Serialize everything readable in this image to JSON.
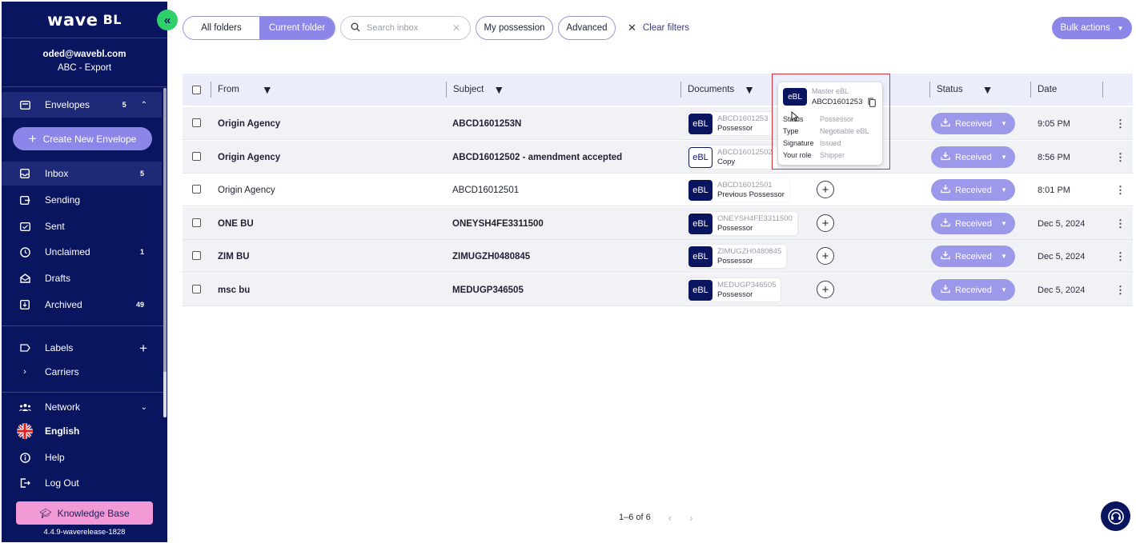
{
  "brand": {
    "name": "wave",
    "suffix": "BL"
  },
  "account": {
    "email": "oded@wavebl.com",
    "org": "ABC - Export"
  },
  "nav": {
    "envelopes": {
      "label": "Envelopes",
      "count": "5"
    },
    "create_label": "Create New Envelope",
    "items": [
      {
        "label": "Inbox",
        "count": "5",
        "icon": "inbox-icon"
      },
      {
        "label": "Sending",
        "count": "",
        "icon": "sending-icon"
      },
      {
        "label": "Sent",
        "count": "",
        "icon": "sent-icon"
      },
      {
        "label": "Unclaimed",
        "count": "1",
        "icon": "clock-icon"
      },
      {
        "label": "Drafts",
        "count": "",
        "icon": "drafts-icon"
      },
      {
        "label": "Archived",
        "count": "49",
        "icon": "archive-icon"
      }
    ],
    "labels": "Labels",
    "carriers": "Carriers",
    "network": "Network",
    "language": "English",
    "help": "Help",
    "logout": "Log Out",
    "knowledge_base": "Knowledge Base",
    "version": "4.4.9-waverelease-1828"
  },
  "toolbar": {
    "all_folders": "All folders",
    "current_folder": "Current folder",
    "search_placeholder": "Search inbox",
    "my_possession": "My possession",
    "advanced": "Advanced",
    "clear_filters": "Clear filters",
    "bulk_actions": "Bulk actions"
  },
  "table": {
    "headers": {
      "from": "From",
      "subject": "Subject",
      "documents": "Documents",
      "status": "Status",
      "date": "Date"
    },
    "rows": [
      {
        "from": "Origin Agency",
        "subject": "ABCD1601253N",
        "doc_ref": "ABCD1601253",
        "doc_role": "Possessor",
        "doc_type": "eBL",
        "status": "Received",
        "date": "9:05 PM",
        "bold": true,
        "grey": true,
        "outline": false,
        "plus": false
      },
      {
        "from": "Origin Agency",
        "subject": "ABCD16012502 - amendment accepted",
        "doc_ref": "ABCD16012502",
        "doc_role": "Copy",
        "doc_type": "eBL",
        "status": "Received",
        "date": "8:56 PM",
        "bold": true,
        "grey": true,
        "outline": true,
        "plus": false
      },
      {
        "from": "Origin Agency",
        "subject": "ABCD16012501",
        "doc_ref": "ABCD16012501",
        "doc_role": "Previous Possessor",
        "doc_type": "eBL",
        "status": "Received",
        "date": "8:01 PM",
        "bold": false,
        "grey": false,
        "outline": false,
        "plus": true
      },
      {
        "from": "ONE BU",
        "subject": "ONEYSH4FE3311500",
        "doc_ref": "ONEYSH4FE3311500",
        "doc_role": "Possessor",
        "doc_type": "eBL",
        "status": "Received",
        "date": "Dec 5, 2024",
        "bold": true,
        "grey": true,
        "outline": false,
        "plus": true
      },
      {
        "from": "ZIM BU",
        "subject": "ZIMUGZH0480845",
        "doc_ref": "ZIMUGZH0480845",
        "doc_role": "Possessor",
        "doc_type": "eBL",
        "status": "Received",
        "date": "Dec 5, 2024",
        "bold": true,
        "grey": true,
        "outline": false,
        "plus": true
      },
      {
        "from": "msc bu",
        "subject": "MEDUGP346505",
        "doc_ref": "MEDUGP346505",
        "doc_role": "Possessor",
        "doc_type": "eBL",
        "status": "Received",
        "date": "Dec 5, 2024",
        "bold": true,
        "grey": true,
        "outline": false,
        "plus": true
      }
    ]
  },
  "tooltip": {
    "badge": "eBL",
    "title": "Master eBL",
    "ref": "ABCD1601253",
    "rows": [
      {
        "k": "Status",
        "v": "Possessor"
      },
      {
        "k": "Type",
        "v": "Negotiable eBL"
      },
      {
        "k": "Signature",
        "v": "Issued"
      },
      {
        "k": "Your role",
        "v": "Shipper"
      }
    ]
  },
  "pagination": {
    "label": "1–6 of 6"
  },
  "colors": {
    "sidebar": "#0a1560",
    "accent": "#8b86e8",
    "status": "#9c98ea",
    "kb": "#f19ad6",
    "collapse": "#2fd06a"
  }
}
